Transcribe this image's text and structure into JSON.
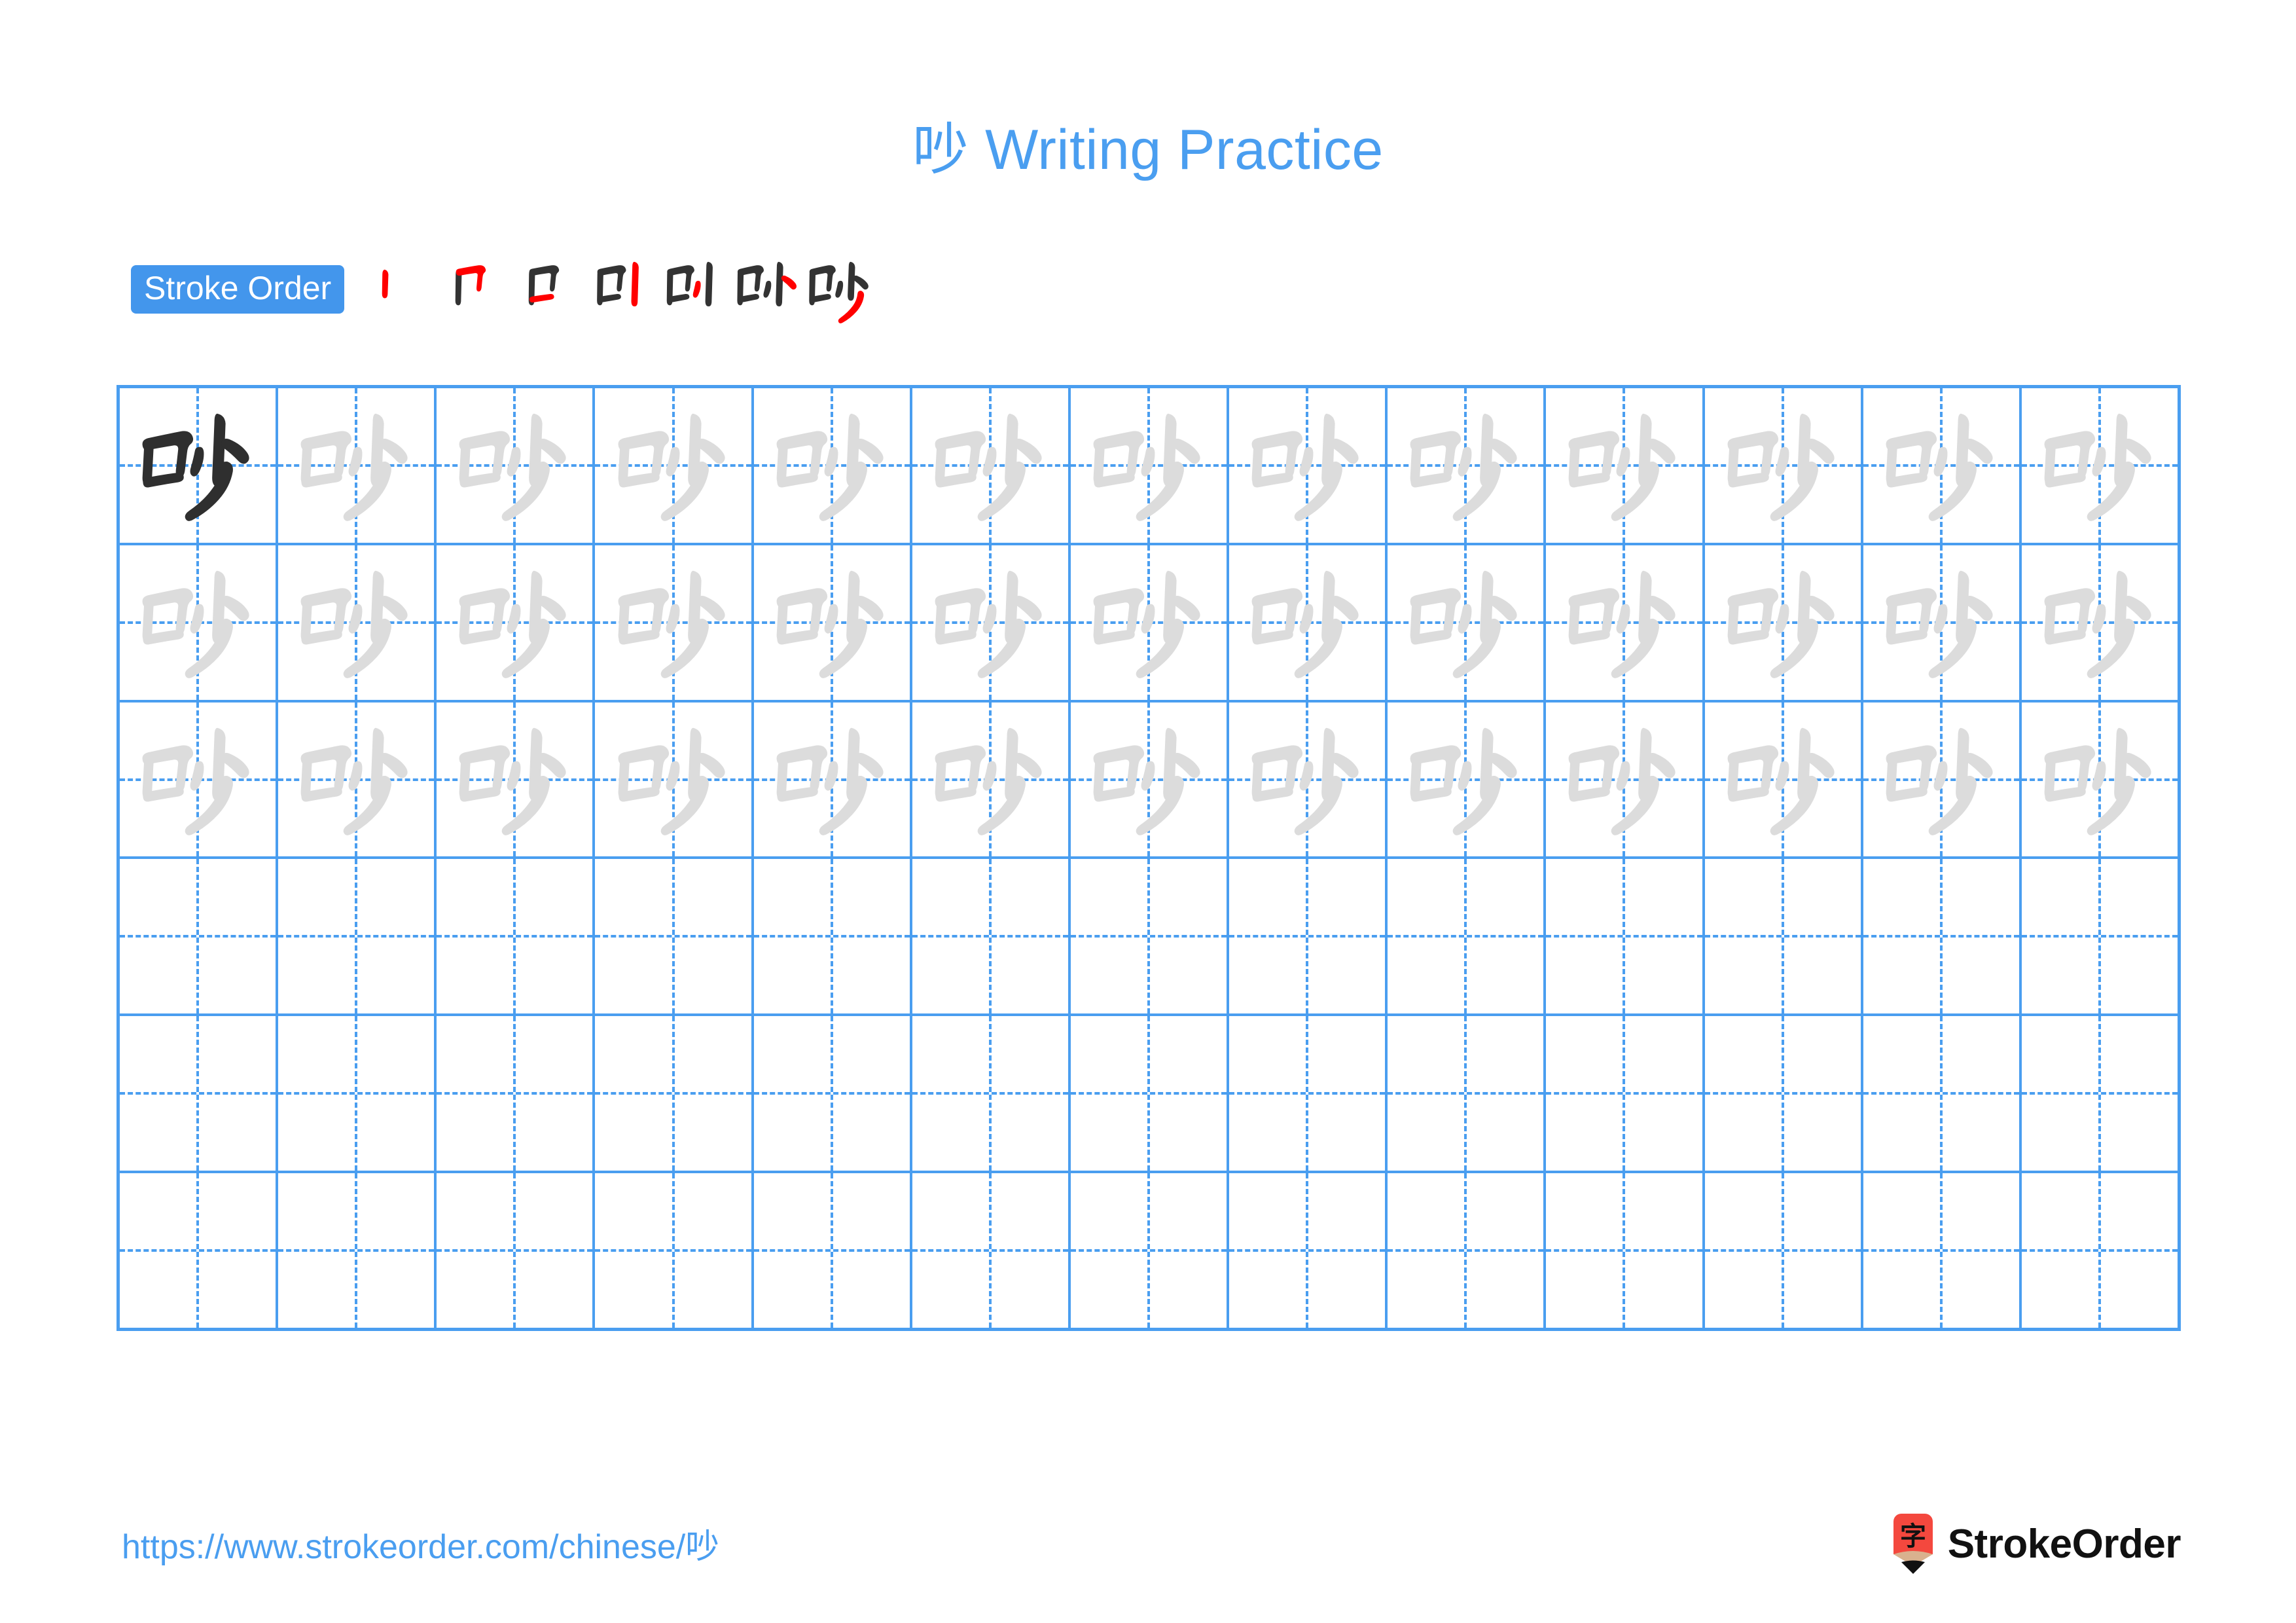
{
  "page": {
    "character": "吵",
    "title": "吵 Writing Practice",
    "title_char": "吵",
    "title_suffix": " Writing Practice",
    "background": "#ffffff",
    "accent_blue": "#4a9ef0",
    "badge_blue": "#4396ec",
    "stroke_new_color": "#ff0000",
    "stroke_done_color": "#333333",
    "trace_gray": "#dcdcdc",
    "ink_dark": "#2f2f2f"
  },
  "stroke_order": {
    "label": "Stroke Order",
    "total_strokes": 7,
    "steps": [
      {
        "index": 1,
        "name": "stroke-step-1",
        "strokes_done": 0,
        "new_stroke": 1
      },
      {
        "index": 2,
        "name": "stroke-step-2",
        "strokes_done": 1,
        "new_stroke": 2
      },
      {
        "index": 3,
        "name": "stroke-step-3",
        "strokes_done": 2,
        "new_stroke": 3
      },
      {
        "index": 4,
        "name": "stroke-step-4",
        "strokes_done": 3,
        "new_stroke": 4
      },
      {
        "index": 5,
        "name": "stroke-step-5",
        "strokes_done": 4,
        "new_stroke": 5
      },
      {
        "index": 6,
        "name": "stroke-step-6",
        "strokes_done": 5,
        "new_stroke": 6
      },
      {
        "index": 7,
        "name": "stroke-step-7",
        "strokes_done": 6,
        "new_stroke": 7
      }
    ]
  },
  "practice_grid": {
    "columns": 13,
    "rows": 6,
    "filled_rows": 3,
    "empty_rows": 3,
    "first_cell_style": "dark",
    "trace_cell_style": "light-gray",
    "guide_lines": "dashed-cross",
    "rows_data": [
      {
        "row": 1,
        "cells": [
          "dark",
          "trace",
          "trace",
          "trace",
          "trace",
          "trace",
          "trace",
          "trace",
          "trace",
          "trace",
          "trace",
          "trace",
          "trace"
        ]
      },
      {
        "row": 2,
        "cells": [
          "trace",
          "trace",
          "trace",
          "trace",
          "trace",
          "trace",
          "trace",
          "trace",
          "trace",
          "trace",
          "trace",
          "trace",
          "trace"
        ]
      },
      {
        "row": 3,
        "cells": [
          "trace",
          "trace",
          "trace",
          "trace",
          "trace",
          "trace",
          "trace",
          "trace",
          "trace",
          "trace",
          "trace",
          "trace",
          "trace"
        ]
      },
      {
        "row": 4,
        "cells": [
          "empty",
          "empty",
          "empty",
          "empty",
          "empty",
          "empty",
          "empty",
          "empty",
          "empty",
          "empty",
          "empty",
          "empty",
          "empty"
        ]
      },
      {
        "row": 5,
        "cells": [
          "empty",
          "empty",
          "empty",
          "empty",
          "empty",
          "empty",
          "empty",
          "empty",
          "empty",
          "empty",
          "empty",
          "empty",
          "empty"
        ]
      },
      {
        "row": 6,
        "cells": [
          "empty",
          "empty",
          "empty",
          "empty",
          "empty",
          "empty",
          "empty",
          "empty",
          "empty",
          "empty",
          "empty",
          "empty",
          "empty"
        ]
      }
    ]
  },
  "footer": {
    "url": "https://www.strokeorder.com/chinese/吵",
    "url_prefix": "https://www.strokeorder.com/chinese/",
    "url_char": "吵",
    "brand_name": "StrokeOrder",
    "brand_mark_char": "字",
    "brand_mark_color": "#f4483e",
    "brand_mark_tip_color": "#d9b18e"
  }
}
